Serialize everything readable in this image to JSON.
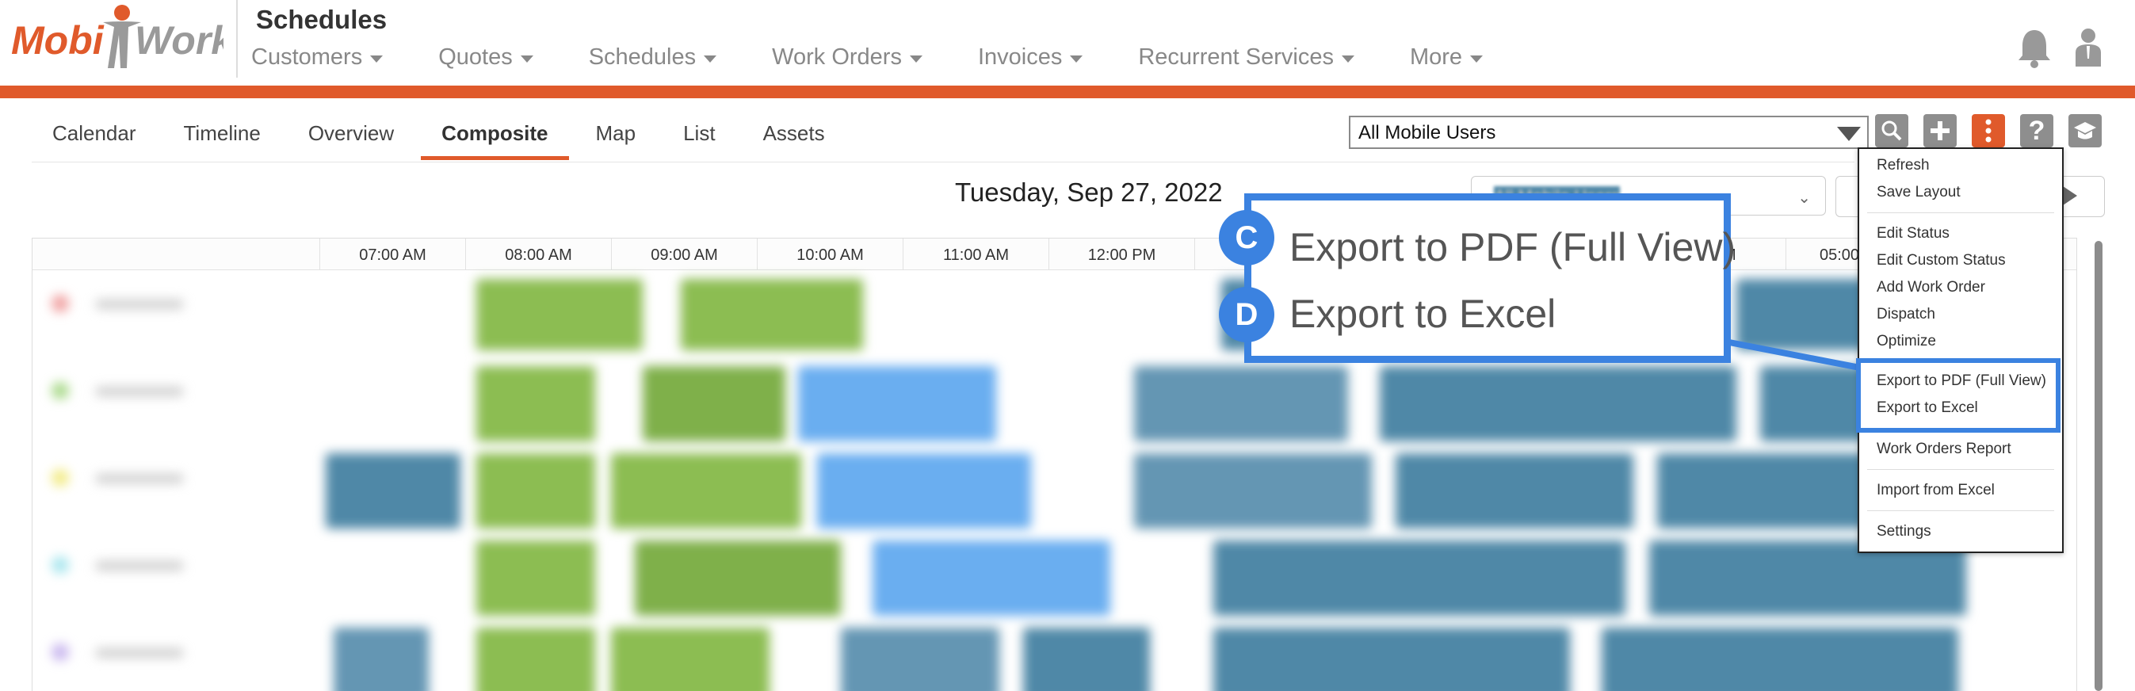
{
  "app": {
    "logo": "MobiWork",
    "title": "Schedules"
  },
  "nav": {
    "items": [
      "Customers",
      "Quotes",
      "Schedules",
      "Work Orders",
      "Invoices",
      "Recurrent Services",
      "More"
    ]
  },
  "tabs": {
    "items": [
      "Calendar",
      "Timeline",
      "Overview",
      "Composite",
      "Map",
      "List",
      "Assets"
    ],
    "active": "Composite"
  },
  "toolbar": {
    "user_select_value": "All Mobile Users",
    "icons": [
      "search-icon",
      "plus-icon",
      "more-vertical-icon",
      "help-icon",
      "graduation-cap-icon"
    ]
  },
  "date": {
    "title": "Tuesday, Sep 27, 2022",
    "secondary_select": "All Mobile Users"
  },
  "timeline": {
    "hours": [
      "07:00 AM",
      "08:00 AM",
      "09:00 AM",
      "10:00 AM",
      "11:00 AM",
      "12:00 PM",
      "",
      "",
      "",
      "M",
      "05:00"
    ]
  },
  "menu": {
    "items": [
      "Refresh",
      "Save Layout",
      "Edit Status",
      "Edit Custom Status",
      "Add Work Order",
      "Dispatch",
      "Optimize",
      "Export to PDF (Full View)",
      "Export to Excel",
      "Work Orders Report",
      "Import from Excel",
      "Settings"
    ]
  },
  "callout": {
    "c_label": "C",
    "c_text": "Export to PDF (Full View)",
    "d_label": "D",
    "d_text": "Export to Excel"
  },
  "colors": {
    "accent": "#e05a2b",
    "highlight": "#3b82e0",
    "green": "#8cbd52",
    "blue": "#6aaef0",
    "teal": "#4f88a7"
  }
}
